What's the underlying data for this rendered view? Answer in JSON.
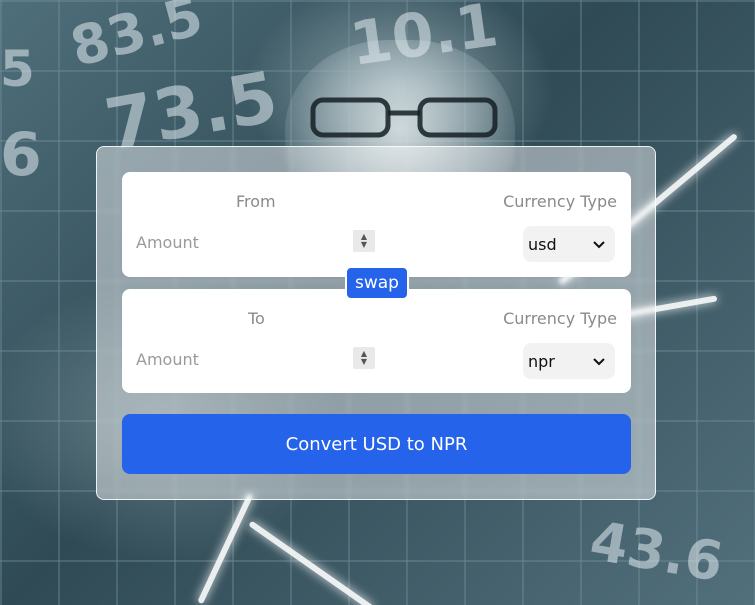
{
  "from": {
    "label": "From",
    "currency_label": "Currency Type",
    "amount_placeholder": "Amount",
    "currency": "usd"
  },
  "to": {
    "label": "To",
    "currency_label": "Currency Type",
    "amount_placeholder": "Amount",
    "currency": "npr"
  },
  "swap_label": "swap",
  "convert_label": "Convert USD to NPR",
  "colors": {
    "accent": "#2563eb",
    "card_bg": "#ffffff"
  },
  "icons": {
    "select_arrow": "chevron-down-icon",
    "spinner": "number-spinner-icon"
  }
}
